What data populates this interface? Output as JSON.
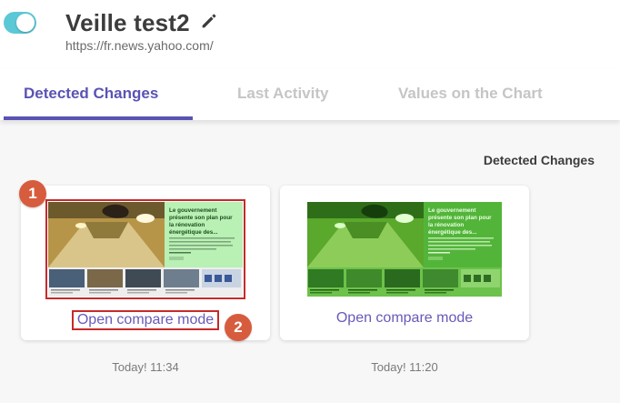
{
  "header": {
    "monitor_enabled": true,
    "title": "Veille test2",
    "url": "https://fr.news.yahoo.com/"
  },
  "tabs": [
    {
      "label": "Detected Changes",
      "active": true
    },
    {
      "label": "Last Activity",
      "active": false
    },
    {
      "label": "Values on the Chart",
      "active": false
    }
  ],
  "section": {
    "heading": "Detected Changes"
  },
  "cards": [
    {
      "link": "Open compare mode",
      "timestamp": "Today! 11:34",
      "tint": "none"
    },
    {
      "link": "Open compare mode",
      "timestamp": "Today! 11:20",
      "tint": "green"
    }
  ],
  "preview": {
    "headline": [
      "Le gouvernement",
      "présente son plan pour",
      "la rénovation",
      "énergétique des..."
    ]
  },
  "callouts": [
    "1",
    "2"
  ],
  "colors": {
    "accent": "#5a53b5",
    "toggle": "#5bc8d6",
    "callout": "#d75c3e",
    "highlight_box": "#c62a2a",
    "tint_green": "#3fb31f"
  }
}
